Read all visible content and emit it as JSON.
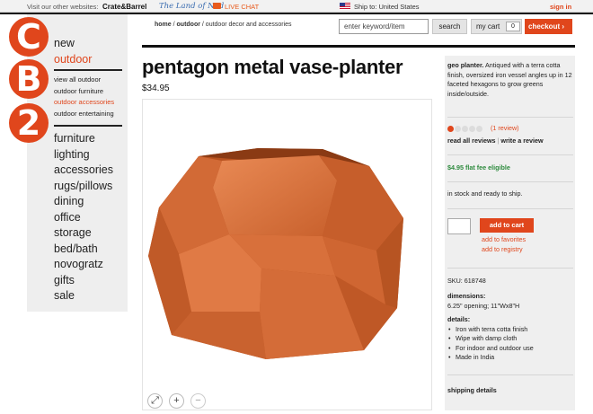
{
  "topbar": {
    "other_sites": "Visit our other websites:",
    "crate_barrel": "Crate&Barrel",
    "land_of_nod": "The Land of Nod",
    "live_chat": "LIVE CHAT",
    "ship_to": "Ship to: United States",
    "sign_in": "sign in"
  },
  "logo": {
    "letters": [
      "C",
      "B",
      "2"
    ]
  },
  "nav": {
    "top": [
      "new",
      "outdoor"
    ],
    "outdoor_sub": [
      "view all outdoor",
      "outdoor furniture",
      "outdoor accessories",
      "outdoor entertaining"
    ],
    "categories": [
      "furniture",
      "lighting",
      "accessories",
      "rugs/pillows",
      "dining",
      "office",
      "storage",
      "bed/bath",
      "novogratz",
      "gifts",
      "sale"
    ]
  },
  "breadcrumb": {
    "home": "home",
    "sep": " / ",
    "outdoor": "outdoor",
    "current": "outdoor decor and accessories"
  },
  "search": {
    "placeholder": "enter keyword/item",
    "button": "search"
  },
  "cart": {
    "label": "my cart",
    "count": "0",
    "checkout": "checkout ›"
  },
  "product": {
    "title": "pentagon metal vase-planter",
    "price": "$34.95",
    "name_bold": "geo planter.",
    "description": "Antiqued with a terra cotta finish, oversized iron vessel angles up in 12 faceted hexagons to grow greens inside/outside.",
    "rating_stars": 1,
    "rating_max": 5,
    "reviews": "(1 review)",
    "read_reviews": "read all reviews",
    "write_review": "write a review",
    "shipping_offer": "$4.95 flat fee eligible",
    "stock": "in stock and ready to ship.",
    "add_to_cart": "add to cart",
    "add_to_favorites": "add to favorites",
    "add_to_registry": "add to registry",
    "sku": "SKU: 618748",
    "dimensions_label": "dimensions:",
    "dimensions": "6.25\" opening; 11\"Wx8\"H",
    "details_label": "details:",
    "details": [
      "Iron with terra cotta finish",
      "Wipe with damp cloth",
      "For indoor and outdoor use",
      "Made in India"
    ],
    "shipping_details": "shipping details"
  },
  "image_controls": {
    "expand": "⤢",
    "zoom_in": "+",
    "zoom_out": "−"
  },
  "colors": {
    "accent": "#e0461c",
    "planter": "#d9733f"
  }
}
